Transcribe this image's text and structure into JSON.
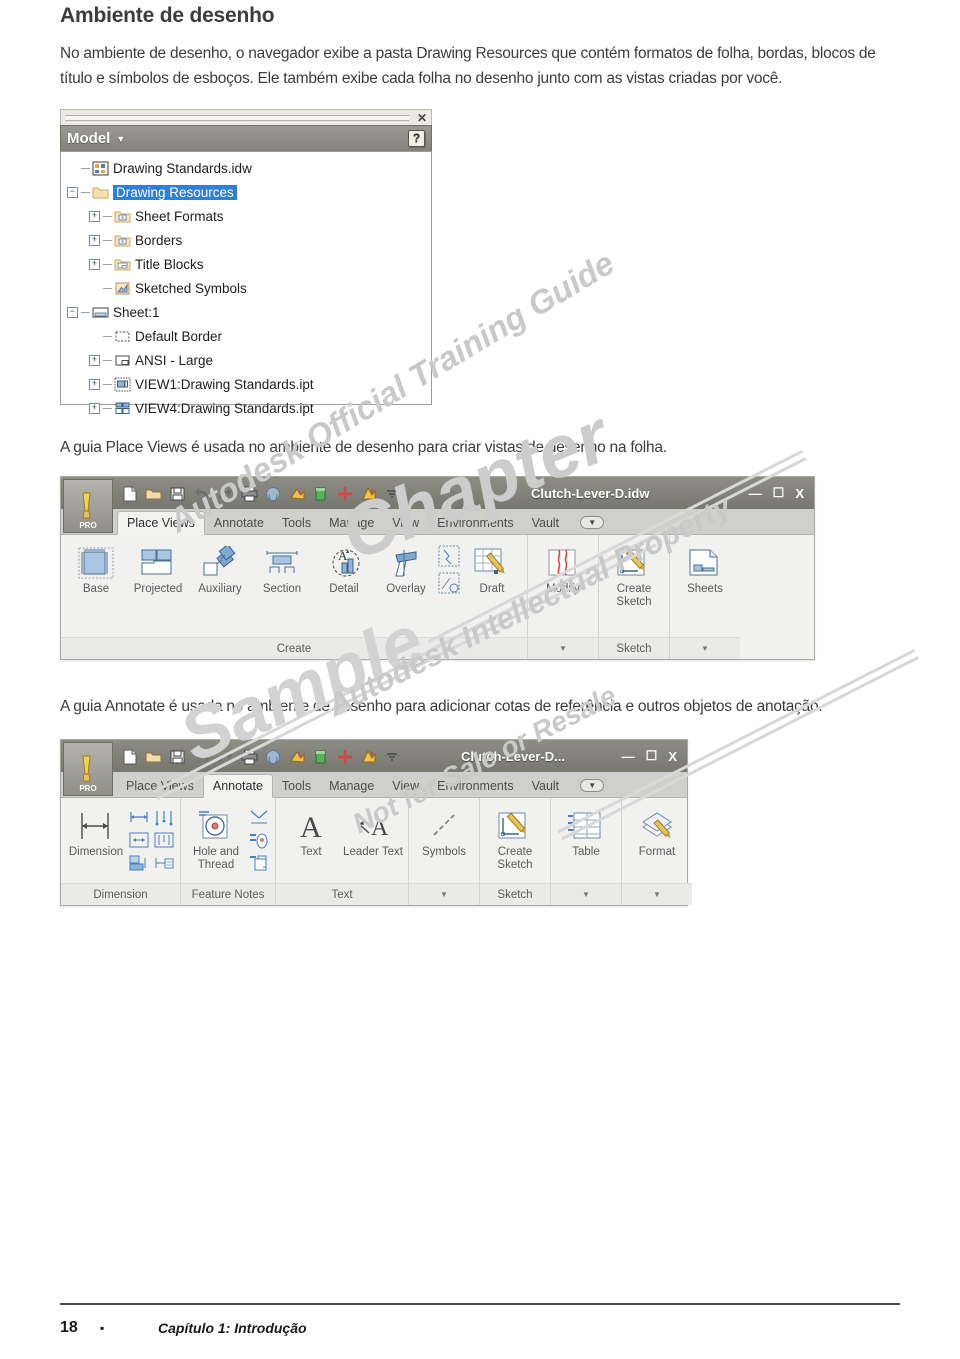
{
  "page": {
    "heading": "Ambiente de desenho",
    "intro": "No ambiente de desenho, o navegador exibe a pasta Drawing Resources que contém formatos de folha, bordas, blocos de título e símbolos de esboços. Ele também exibe cada folha no desenho junto com as vistas criadas por você.",
    "caption_place_views": "A guia Place Views é usada no ambiente de desenho para criar vistas de desenho na folha.",
    "caption_annotate": "A guia Annotate é usada no ambiente de desenho para adicionar cotas de referência e outros objetos de anotação."
  },
  "watermark": {
    "line1": "Autodesk Official Training Guide",
    "line2": "Chapter",
    "line3": "Sample",
    "line4": "Autodesk Intellectual Property",
    "line5": "Not for Sale or Resale"
  },
  "browser_panel": {
    "close_label": "✕",
    "title": "Model",
    "caret": "▼",
    "help_label": "?",
    "tree": [
      {
        "label": "Drawing Standards.idw",
        "indent": 0,
        "toggle": "none",
        "icon": "assembly-icon",
        "selected": false
      },
      {
        "label": "Drawing Resources",
        "indent": 0,
        "toggle": "minus",
        "icon": "folder-icon",
        "selected": true
      },
      {
        "label": "Sheet Formats",
        "indent": 1,
        "toggle": "plus",
        "icon": "sheet-format-icon",
        "selected": false
      },
      {
        "label": "Borders",
        "indent": 1,
        "toggle": "plus",
        "icon": "border-folder-icon",
        "selected": false
      },
      {
        "label": "Title Blocks",
        "indent": 1,
        "toggle": "plus",
        "icon": "title-block-icon",
        "selected": false
      },
      {
        "label": "Sketched Symbols",
        "indent": 1,
        "toggle": "none",
        "icon": "sketched-symbol-icon",
        "selected": false
      },
      {
        "label": "Sheet:1",
        "indent": 0,
        "toggle": "minus",
        "icon": "sheet-icon",
        "selected": false
      },
      {
        "label": "Default Border",
        "indent": 1,
        "toggle": "none",
        "icon": "default-border-icon",
        "selected": false
      },
      {
        "label": "ANSI - Large",
        "indent": 1,
        "toggle": "plus",
        "icon": "ansi-large-icon",
        "selected": false
      },
      {
        "label": "VIEW1:Drawing Standards.ipt",
        "indent": 1,
        "toggle": "plus",
        "icon": "view1-icon",
        "selected": false
      },
      {
        "label": "VIEW4:Drawing Standards.ipt",
        "indent": 1,
        "toggle": "plus",
        "icon": "view4-icon",
        "selected": false
      }
    ]
  },
  "ribbon_place_views": {
    "app_button_label": "PRO",
    "window_title": "Clutch-Lever-D.idw",
    "window_buttons": {
      "minimize": "—",
      "maximize": "☐",
      "close": "X"
    },
    "quick_access": [
      "new-icon",
      "open-icon",
      "save-icon",
      "undo-icon",
      "redo-icon",
      "print-icon",
      "select-icon",
      "update-icon",
      "material-icon",
      "return-icon",
      "update2-icon",
      "qat-dropdown-icon"
    ],
    "tabs": [
      "Place Views",
      "Annotate",
      "Tools",
      "Manage",
      "View",
      "Environments",
      "Vault"
    ],
    "active_tab": "Place Views",
    "tab_overflow": "▼",
    "groups": [
      {
        "name": "Create",
        "buttons": [
          "Base",
          "Projected",
          "Auxiliary",
          "Section",
          "Detail",
          "Overlay",
          "Draft"
        ],
        "has_expand": false
      },
      {
        "name": "",
        "buttons": [
          "Modify"
        ],
        "has_expand": true
      },
      {
        "name": "Sketch",
        "buttons": [
          "Create Sketch"
        ],
        "has_expand": false
      },
      {
        "name": "",
        "buttons": [
          "Sheets"
        ],
        "has_expand": true
      }
    ]
  },
  "ribbon_annotate": {
    "app_button_label": "PRO",
    "window_title": "Clutch-Lever-D...",
    "window_buttons": {
      "minimize": "—",
      "maximize": "☐",
      "close": "X"
    },
    "quick_access": [
      "new-icon",
      "open-icon",
      "save-icon",
      "undo-icon",
      "redo-icon",
      "print-icon",
      "select-icon",
      "update-icon",
      "material-icon",
      "dimension-icon",
      "update2-icon",
      "qat-dropdown-icon"
    ],
    "tabs": [
      "Place Views",
      "Annotate",
      "Tools",
      "Manage",
      "View",
      "Environments",
      "Vault"
    ],
    "active_tab": "Annotate",
    "tab_overflow": "▼",
    "groups": [
      {
        "name": "Dimension",
        "buttons": [
          "Dimension"
        ],
        "has_expand": false
      },
      {
        "name": "Feature Notes",
        "buttons": [
          "Hole and Thread"
        ],
        "has_expand": false
      },
      {
        "name": "Text",
        "buttons": [
          "Text",
          "Leader Text"
        ],
        "has_expand": false
      },
      {
        "name": "",
        "buttons": [
          "Symbols"
        ],
        "has_expand": true
      },
      {
        "name": "Sketch",
        "buttons": [
          "Create Sketch"
        ],
        "has_expand": false
      },
      {
        "name": "",
        "buttons": [
          "Table"
        ],
        "has_expand": true
      },
      {
        "name": "",
        "buttons": [
          "Format"
        ],
        "has_expand": true
      }
    ]
  },
  "footer": {
    "page_number": "18",
    "bullet": "▪",
    "chapter": "Capítulo 1: Introdução"
  }
}
